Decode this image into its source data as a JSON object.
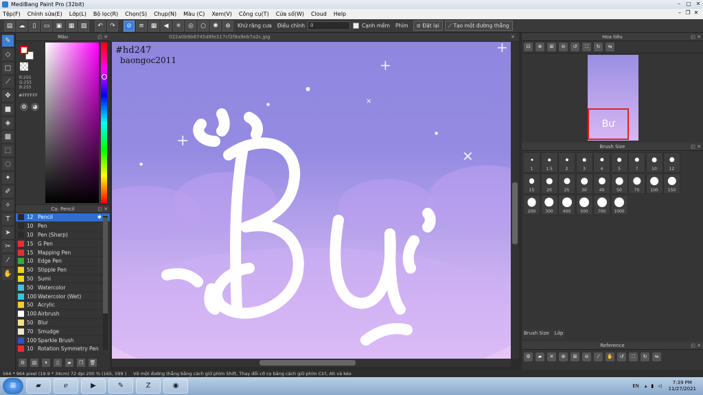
{
  "title": "MediBang Paint Pro (32bit)",
  "menu": [
    "Tệp(F)",
    "Chỉnh sửa(E)",
    "Lớp(L)",
    "Bộ lọc(R)",
    "Chọn(S)",
    "Chụp(N)",
    "Màu (C)",
    "Xem(V)",
    "Công cụ(T)",
    "Cửa sổ(W)",
    "Cloud",
    "Help"
  ],
  "toolbar": {
    "antialias_label": "Khử răng cưa",
    "adjust_label": "Điều chỉnh",
    "adjust_value": "0",
    "soft_edge_label": "Cạnh mềm",
    "key_label": "Phím",
    "reset_label": "Đặt lại",
    "line_label": "Tạo một đường thẳng"
  },
  "color_panel": {
    "title": "Màu",
    "r": "R:255",
    "g": "G:255",
    "b": "B:255",
    "hex": "#FFFFFF"
  },
  "brush_panel": {
    "title": "Cọ: Pencil",
    "items": [
      {
        "size": "12",
        "name": "Pencil",
        "color": "#2a2a2a",
        "selected": true
      },
      {
        "size": "10",
        "name": "Pen",
        "color": "#2a2a2a"
      },
      {
        "size": "10",
        "name": "Pen (Sharp)",
        "color": "#2a2a2a"
      },
      {
        "size": "15",
        "name": "G Pen",
        "color": "#e53030"
      },
      {
        "size": "15",
        "name": "Mapping Pen",
        "color": "#e53030"
      },
      {
        "size": "10",
        "name": "Edge Pen",
        "color": "#29b32a"
      },
      {
        "size": "50",
        "name": "Stipple Pen",
        "color": "#f0d020"
      },
      {
        "size": "50",
        "name": "Sumi",
        "color": "#f0d020"
      },
      {
        "size": "50",
        "name": "Watercolor",
        "color": "#36c4e0"
      },
      {
        "size": "100",
        "name": "Watercolor (Wet)",
        "color": "#36c4e0"
      },
      {
        "size": "50",
        "name": "Acrylic",
        "color": "#f0d020"
      },
      {
        "size": "100",
        "name": "Airbrush",
        "color": "#ffffff"
      },
      {
        "size": "50",
        "name": "Blur",
        "color": "#f7e080"
      },
      {
        "size": "70",
        "name": "Smudge",
        "color": "#f2e6c8"
      },
      {
        "size": "100",
        "name": "Sparkle Brush",
        "color": "#3050d0"
      },
      {
        "size": "10",
        "name": "Rotation Symmetry Pen",
        "color": "#e53030"
      }
    ]
  },
  "document": {
    "tab": "022a0b9b8745d8fe317cf2f8a9eb7a2c.jpg",
    "sig1": "#hd247",
    "sig2": "baongoc2011",
    "art_text": "Bư"
  },
  "navigator": {
    "title": "Hoa tiêu",
    "thumb_text": "Bư"
  },
  "brush_size": {
    "title": "Brush Size",
    "sizes": [
      "1",
      "1.5",
      "2",
      "3",
      "4",
      "5",
      "7",
      "10",
      "12",
      "15",
      "20",
      "25",
      "30",
      "40",
      "50",
      "70",
      "100",
      "150",
      "200",
      "300",
      "400",
      "500",
      "700",
      "1000"
    ],
    "tabs": [
      "Brush Size",
      "Lớp"
    ]
  },
  "reference": {
    "title": "Reference"
  },
  "status": {
    "dims": "564 * 964 pixel  (19.9 * 34cm)  72 dpi  200 %  (165, 599 )",
    "hint": "Vẽ một đường thẳng bằng cách giữ phím Shift, Thay đổi cỡ cọ bằng cách giữ phím Ctrl, Alt và kéo"
  },
  "taskbar": {
    "lang": "EN",
    "time": "7:39 PM",
    "date": "11/27/2021",
    "apps": [
      "folder",
      "ie",
      "media",
      "medibang",
      "zalo",
      "chrome"
    ]
  }
}
